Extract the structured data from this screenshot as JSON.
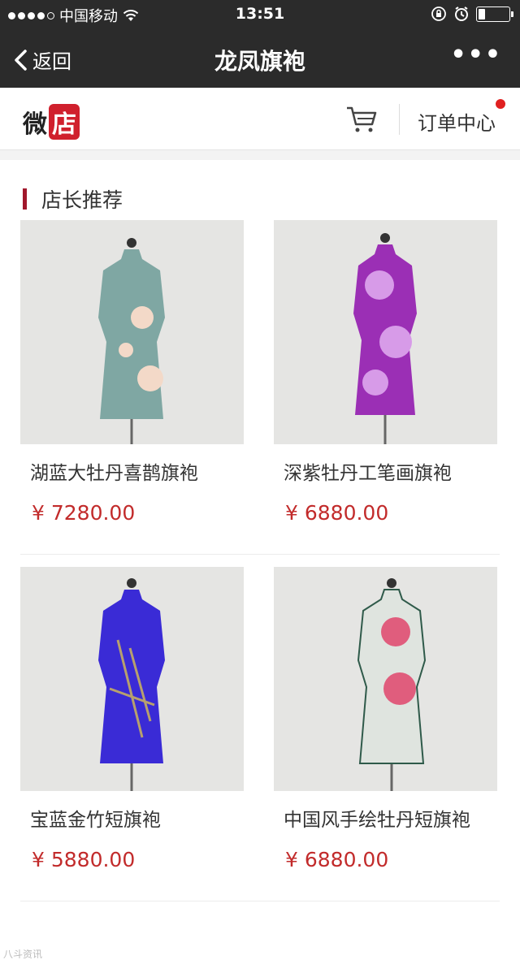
{
  "status_bar": {
    "carrier": "中国移动",
    "time": "13:51"
  },
  "nav": {
    "back_label": "返回",
    "title": "龙凤旗袍",
    "more": "•••"
  },
  "shop_header": {
    "logo_part1": "微",
    "logo_part2": "店",
    "orders_label": "订单中心"
  },
  "section": {
    "title": "店长推荐"
  },
  "products": [
    {
      "name": "湖蓝大牡丹喜鹊旗袍",
      "price": "¥ 7280.00",
      "dress_color": "#7fa7a3",
      "accent": "#f3d9c8"
    },
    {
      "name": "深紫牡丹工笔画旗袍",
      "price": "¥ 6880.00",
      "dress_color": "#9b2fb5",
      "accent": "#d79be8"
    },
    {
      "name": "宝蓝金竹短旗袍",
      "price": "¥ 5880.00",
      "dress_color": "#3a2bd6",
      "accent": "#b7a06e"
    },
    {
      "name": "中国风手绘牡丹短旗袍",
      "price": "¥ 6880.00",
      "dress_color": "#dfe4df",
      "accent": "#e05d7d"
    }
  ],
  "watermark": "八斗资讯",
  "colors": {
    "accent_red": "#c22b2b",
    "nav_bg": "#2b2b2b",
    "section_bar": "#a1182c"
  }
}
